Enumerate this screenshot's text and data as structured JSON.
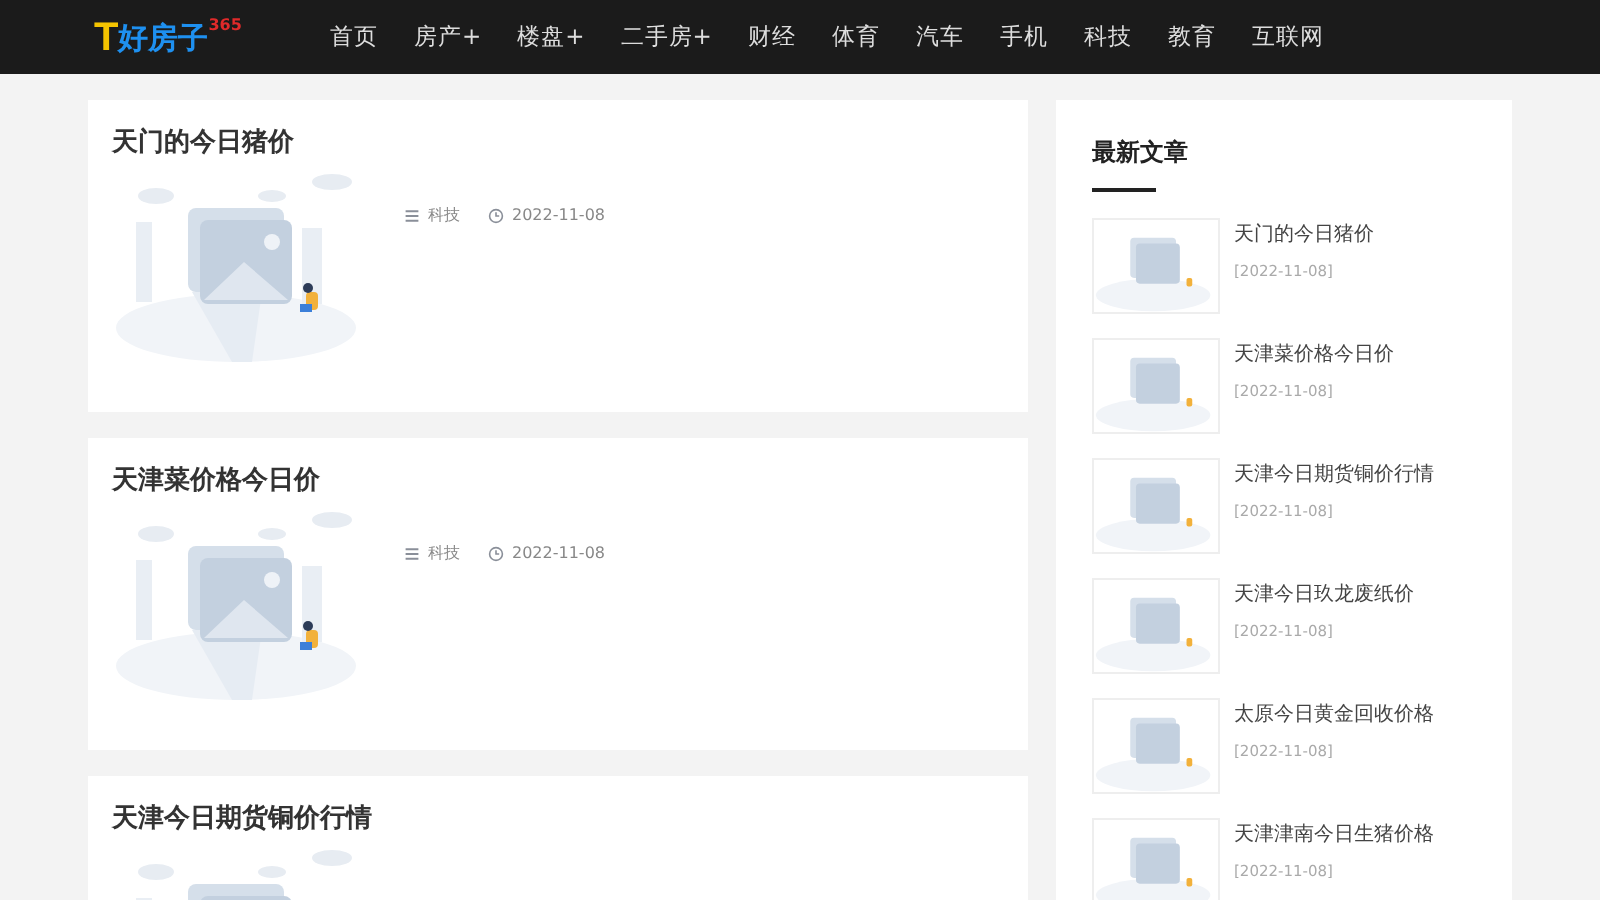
{
  "header": {
    "logo": {
      "mark": "T",
      "name": "好房子",
      "sup": "365"
    },
    "nav": [
      {
        "label": "首页"
      },
      {
        "label": "房产+"
      },
      {
        "label": "楼盘+"
      },
      {
        "label": "二手房+"
      },
      {
        "label": "财经"
      },
      {
        "label": "体育"
      },
      {
        "label": "汽车"
      },
      {
        "label": "手机"
      },
      {
        "label": "科技"
      },
      {
        "label": "教育"
      },
      {
        "label": "互联网"
      }
    ]
  },
  "articles": [
    {
      "title": "天门的今日猪价",
      "category": "科技",
      "date": "2022-11-08"
    },
    {
      "title": "天津菜价格今日价",
      "category": "科技",
      "date": "2022-11-08"
    },
    {
      "title": "天津今日期货铜价行情"
    }
  ],
  "sidebar": {
    "title": "最新文章",
    "items": [
      {
        "title": "天门的今日猪价",
        "date": "[2022-11-08]"
      },
      {
        "title": "天津菜价格今日价",
        "date": "[2022-11-08]"
      },
      {
        "title": "天津今日期货铜价行情",
        "date": "[2022-11-08]"
      },
      {
        "title": "天津今日玖龙废纸价",
        "date": "[2022-11-08]"
      },
      {
        "title": "太原今日黄金回收价格",
        "date": "[2022-11-08]"
      },
      {
        "title": "天津津南今日生猪价格",
        "date": "[2022-11-08]"
      }
    ]
  }
}
